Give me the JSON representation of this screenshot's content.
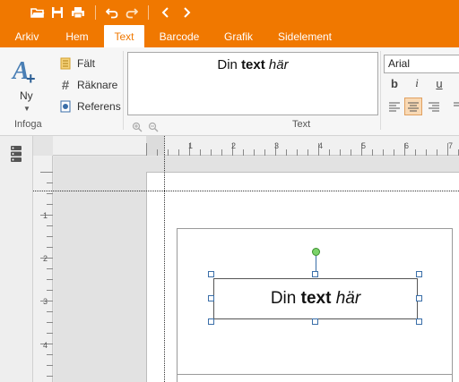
{
  "quick_access": {
    "icons": [
      "folder-open-icon",
      "save-icon",
      "print-icon",
      "undo-icon",
      "redo-icon",
      "back-icon",
      "forward-icon"
    ]
  },
  "tabs": [
    {
      "label": "Arkiv",
      "active": false
    },
    {
      "label": "Hem",
      "active": false
    },
    {
      "label": "Text",
      "active": true
    },
    {
      "label": "Barcode",
      "active": false
    },
    {
      "label": "Grafik",
      "active": false
    },
    {
      "label": "Sidelement",
      "active": false
    }
  ],
  "ribbon": {
    "insert_group": {
      "big_button_label": "Ny",
      "group_label": "Infoga",
      "items": [
        {
          "label": "Fält",
          "icon": "field-icon"
        },
        {
          "label": "Räknare",
          "icon": "hash-icon"
        },
        {
          "label": "Referens",
          "icon": "reference-icon"
        }
      ]
    },
    "text_group": {
      "group_label": "Text",
      "preview": {
        "prefix": "Din ",
        "bold": "text",
        "italic": "här"
      }
    },
    "font_group": {
      "font_name": "Arial",
      "format_buttons": [
        {
          "glyph": "b",
          "name": "bold-button"
        },
        {
          "glyph": "i",
          "name": "italic-button"
        },
        {
          "glyph": "u",
          "name": "underline-button"
        }
      ]
    }
  },
  "rulers": {
    "horizontal_ticks": [
      "1",
      "2",
      "3",
      "4",
      "5",
      "6",
      "7"
    ],
    "vertical_ticks": [
      "1",
      "2",
      "3",
      "4"
    ]
  },
  "canvas": {
    "text_object": {
      "prefix": "Din ",
      "bold": "text",
      "italic": "här"
    }
  },
  "colors": {
    "accent": "#f07800",
    "selection_handle": "#3a6ea8",
    "rotate_handle": "#7bd36a"
  }
}
